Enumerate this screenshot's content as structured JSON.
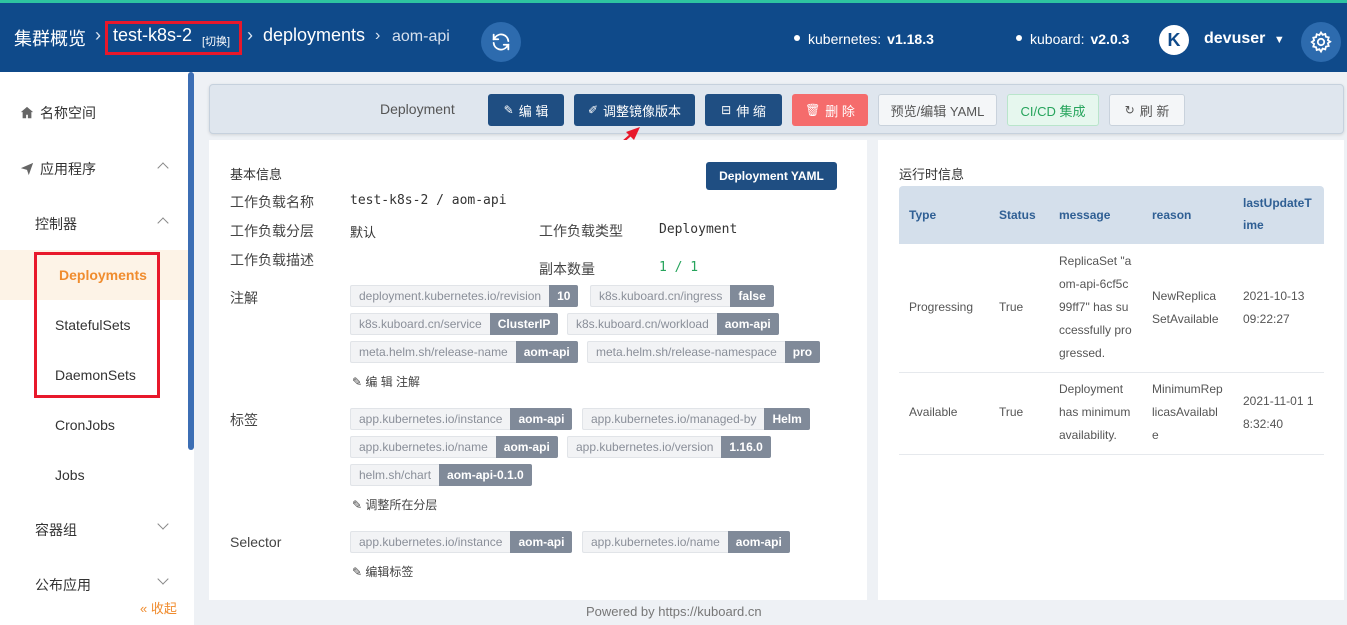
{
  "header": {
    "cluster_overview": "集群概览",
    "cluster_name": "test-k8s-2",
    "switch_label": "[切换]",
    "section": "deployments",
    "workload": "aom-api",
    "kubernetes_label": "kubernetes:",
    "kubernetes_version": "v1.18.3",
    "kuboard_label": "kuboard:",
    "kuboard_version": "v2.0.3",
    "avatar_letter": "K",
    "username": "devuser"
  },
  "sidebar": {
    "namespace": "名称空间",
    "apps": "应用程序",
    "controllers": "控制器",
    "deployments": "Deployments",
    "statefulsets": "StatefulSets",
    "daemonsets": "DaemonSets",
    "cronjobs": "CronJobs",
    "jobs": "Jobs",
    "pods": "容器组",
    "publish": "公布应用",
    "collapse": "« 收起"
  },
  "toolbar": {
    "title": "Deployment",
    "edit": "编 辑",
    "adjust_image": "调整镜像版本",
    "scale": "伸 缩",
    "delete": "删 除",
    "yaml": "预览/编辑 YAML",
    "cicd": "CI/CD 集成",
    "refresh": "刷 新"
  },
  "basic": {
    "section_title": "基本信息",
    "yaml_button": "Deployment YAML",
    "name_label": "工作负载名称",
    "name_value": "test-k8s-2 / aom-api",
    "layer_label": "工作负载分层",
    "layer_value": "默认",
    "type_label": "工作负载类型",
    "type_value": "Deployment",
    "desc_label": "工作负载描述",
    "replicas_label": "副本数量",
    "replicas_value": "1 / 1",
    "annotations_label": "注解",
    "annotations": [
      {
        "k": "deployment.kubernetes.io/revision",
        "v": "10"
      },
      {
        "k": "k8s.kuboard.cn/ingress",
        "v": "false"
      },
      {
        "k": "k8s.kuboard.cn/service",
        "v": "ClusterIP"
      },
      {
        "k": "k8s.kuboard.cn/workload",
        "v": "aom-api"
      },
      {
        "k": "meta.helm.sh/release-name",
        "v": "aom-api"
      },
      {
        "k": "meta.helm.sh/release-namespace",
        "v": "pro"
      }
    ],
    "edit_annotations": "编 辑 注解",
    "labels_label": "标签",
    "labels": [
      {
        "k": "app.kubernetes.io/instance",
        "v": "aom-api"
      },
      {
        "k": "app.kubernetes.io/managed-by",
        "v": "Helm"
      },
      {
        "k": "app.kubernetes.io/name",
        "v": "aom-api"
      },
      {
        "k": "app.kubernetes.io/version",
        "v": "1.16.0"
      },
      {
        "k": "helm.sh/chart",
        "v": "aom-api-0.1.0"
      }
    ],
    "adjust_layer": "调整所在分层",
    "selector_label": "Selector",
    "selector": [
      {
        "k": "app.kubernetes.io/instance",
        "v": "aom-api"
      },
      {
        "k": "app.kubernetes.io/name",
        "v": "aom-api"
      }
    ],
    "edit_labels": "编辑标签"
  },
  "runtime": {
    "section_title": "运行时信息",
    "columns": [
      "Type",
      "Status",
      "message",
      "reason",
      "lastUpdateTime"
    ],
    "column_lines": {
      "last_update_line1": "lastUpdateT",
      "last_update_line2": "ime"
    },
    "rows": [
      {
        "type": "Progressing",
        "status": "True",
        "message_lines": [
          "ReplicaSet \"a",
          "om-api-6cf5c",
          "99ff7\" has su",
          "ccessfully pro",
          "gressed."
        ],
        "reason_lines": [
          "NewReplica",
          "SetAvailable"
        ],
        "time_lines": [
          "2021-10-13",
          "09:22:27"
        ]
      },
      {
        "type": "Available",
        "status": "True",
        "message_lines": [
          "Deployment",
          "has minimum",
          "availability."
        ],
        "reason_lines": [
          "MinimumRep",
          "licasAvailabl",
          "e"
        ],
        "time_lines": [
          "2021-11-01 1",
          "8:32:40"
        ]
      }
    ]
  },
  "footer": {
    "text": "Powered by https://kuboard.cn"
  },
  "colors": {
    "header_bg": "#0f4a8a",
    "primary": "#1f4e82",
    "danger": "#f56c6c",
    "highlight": "#e8182b",
    "active_menu": "#f08c2e",
    "replicas": "#26a45c"
  }
}
